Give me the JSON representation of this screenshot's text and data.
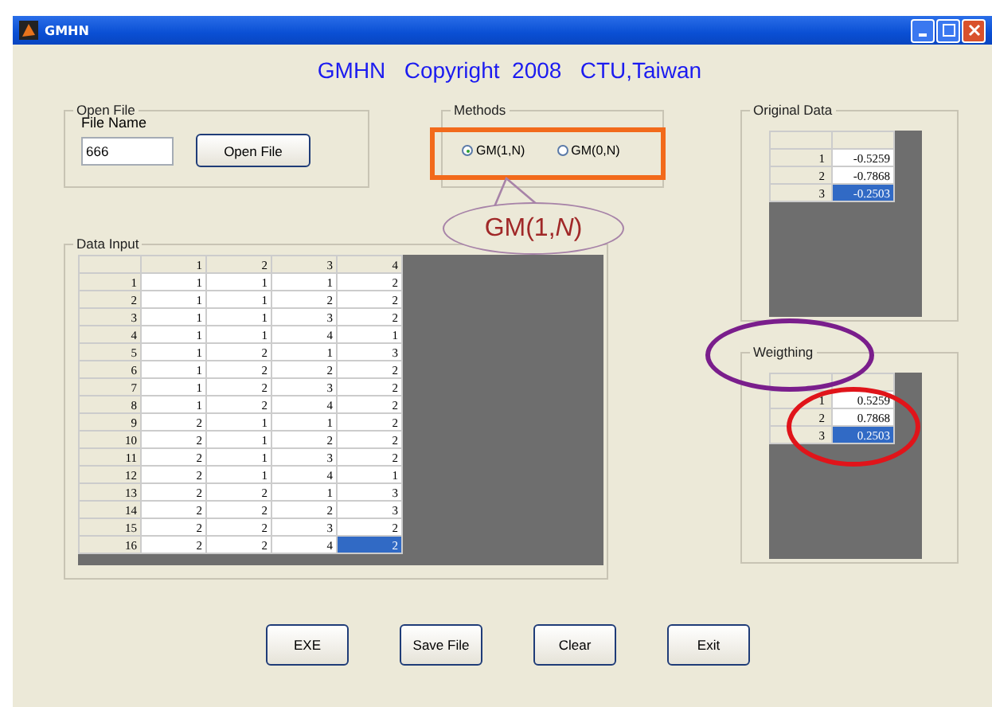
{
  "window": {
    "title": "GMHN"
  },
  "heading": "GMHN   Copyright  2008   CTU,Taiwan",
  "open_file": {
    "title": "Open File",
    "label": "File Name",
    "value": "666",
    "button": "Open File"
  },
  "methods": {
    "title": "Methods",
    "options": [
      {
        "label": "GM(1,N)",
        "selected": true
      },
      {
        "label": "GM(0,N)",
        "selected": false
      }
    ]
  },
  "data_input": {
    "title": "Data Input",
    "columns": [
      "1",
      "2",
      "3",
      "4"
    ],
    "rows": [
      {
        "label": "1",
        "cells": [
          {
            "value": "1",
            "selected": false
          },
          {
            "value": "1",
            "selected": false
          },
          {
            "value": "1",
            "selected": false
          },
          {
            "value": "2",
            "selected": false
          }
        ]
      },
      {
        "label": "2",
        "cells": [
          {
            "value": "1",
            "selected": false
          },
          {
            "value": "1",
            "selected": false
          },
          {
            "value": "2",
            "selected": false
          },
          {
            "value": "2",
            "selected": false
          }
        ]
      },
      {
        "label": "3",
        "cells": [
          {
            "value": "1",
            "selected": false
          },
          {
            "value": "1",
            "selected": false
          },
          {
            "value": "3",
            "selected": false
          },
          {
            "value": "2",
            "selected": false
          }
        ]
      },
      {
        "label": "4",
        "cells": [
          {
            "value": "1",
            "selected": false
          },
          {
            "value": "1",
            "selected": false
          },
          {
            "value": "4",
            "selected": false
          },
          {
            "value": "1",
            "selected": false
          }
        ]
      },
      {
        "label": "5",
        "cells": [
          {
            "value": "1",
            "selected": false
          },
          {
            "value": "2",
            "selected": false
          },
          {
            "value": "1",
            "selected": false
          },
          {
            "value": "3",
            "selected": false
          }
        ]
      },
      {
        "label": "6",
        "cells": [
          {
            "value": "1",
            "selected": false
          },
          {
            "value": "2",
            "selected": false
          },
          {
            "value": "2",
            "selected": false
          },
          {
            "value": "2",
            "selected": false
          }
        ]
      },
      {
        "label": "7",
        "cells": [
          {
            "value": "1",
            "selected": false
          },
          {
            "value": "2",
            "selected": false
          },
          {
            "value": "3",
            "selected": false
          },
          {
            "value": "2",
            "selected": false
          }
        ]
      },
      {
        "label": "8",
        "cells": [
          {
            "value": "1",
            "selected": false
          },
          {
            "value": "2",
            "selected": false
          },
          {
            "value": "4",
            "selected": false
          },
          {
            "value": "2",
            "selected": false
          }
        ]
      },
      {
        "label": "9",
        "cells": [
          {
            "value": "2",
            "selected": false
          },
          {
            "value": "1",
            "selected": false
          },
          {
            "value": "1",
            "selected": false
          },
          {
            "value": "2",
            "selected": false
          }
        ]
      },
      {
        "label": "10",
        "cells": [
          {
            "value": "2",
            "selected": false
          },
          {
            "value": "1",
            "selected": false
          },
          {
            "value": "2",
            "selected": false
          },
          {
            "value": "2",
            "selected": false
          }
        ]
      },
      {
        "label": "11",
        "cells": [
          {
            "value": "2",
            "selected": false
          },
          {
            "value": "1",
            "selected": false
          },
          {
            "value": "3",
            "selected": false
          },
          {
            "value": "2",
            "selected": false
          }
        ]
      },
      {
        "label": "12",
        "cells": [
          {
            "value": "2",
            "selected": false
          },
          {
            "value": "1",
            "selected": false
          },
          {
            "value": "4",
            "selected": false
          },
          {
            "value": "1",
            "selected": false
          }
        ]
      },
      {
        "label": "13",
        "cells": [
          {
            "value": "2",
            "selected": false
          },
          {
            "value": "2",
            "selected": false
          },
          {
            "value": "1",
            "selected": false
          },
          {
            "value": "3",
            "selected": false
          }
        ]
      },
      {
        "label": "14",
        "cells": [
          {
            "value": "2",
            "selected": false
          },
          {
            "value": "2",
            "selected": false
          },
          {
            "value": "2",
            "selected": false
          },
          {
            "value": "3",
            "selected": false
          }
        ]
      },
      {
        "label": "15",
        "cells": [
          {
            "value": "2",
            "selected": false
          },
          {
            "value": "2",
            "selected": false
          },
          {
            "value": "3",
            "selected": false
          },
          {
            "value": "2",
            "selected": false
          }
        ]
      },
      {
        "label": "16",
        "cells": [
          {
            "value": "2",
            "selected": false
          },
          {
            "value": "2",
            "selected": false
          },
          {
            "value": "4",
            "selected": false
          },
          {
            "value": "2",
            "selected": true
          }
        ]
      }
    ]
  },
  "original_data": {
    "title": "Original Data",
    "rows": [
      {
        "label": "1",
        "value": "-0.5259",
        "selected": false
      },
      {
        "label": "2",
        "value": "-0.7868",
        "selected": false
      },
      {
        "label": "3",
        "value": "-0.2503",
        "selected": true
      }
    ]
  },
  "weighting": {
    "title": "Weigthing",
    "rows": [
      {
        "label": "1",
        "value": "0.5259",
        "selected": false
      },
      {
        "label": "2",
        "value": "0.7868",
        "selected": false
      },
      {
        "label": "3",
        "value": "0.2503",
        "selected": true
      }
    ]
  },
  "buttons": [
    "EXE",
    "Save File",
    "Clear",
    "Exit"
  ],
  "annotations": [
    {
      "kind": "rect",
      "color": "#f26a1b"
    },
    {
      "kind": "callout",
      "color": "#a783a8",
      "text": "GM(1,*N*)"
    },
    {
      "kind": "ellipse",
      "color": "#7a1e8c"
    },
    {
      "kind": "ellipse",
      "color": "#e0141a"
    }
  ]
}
